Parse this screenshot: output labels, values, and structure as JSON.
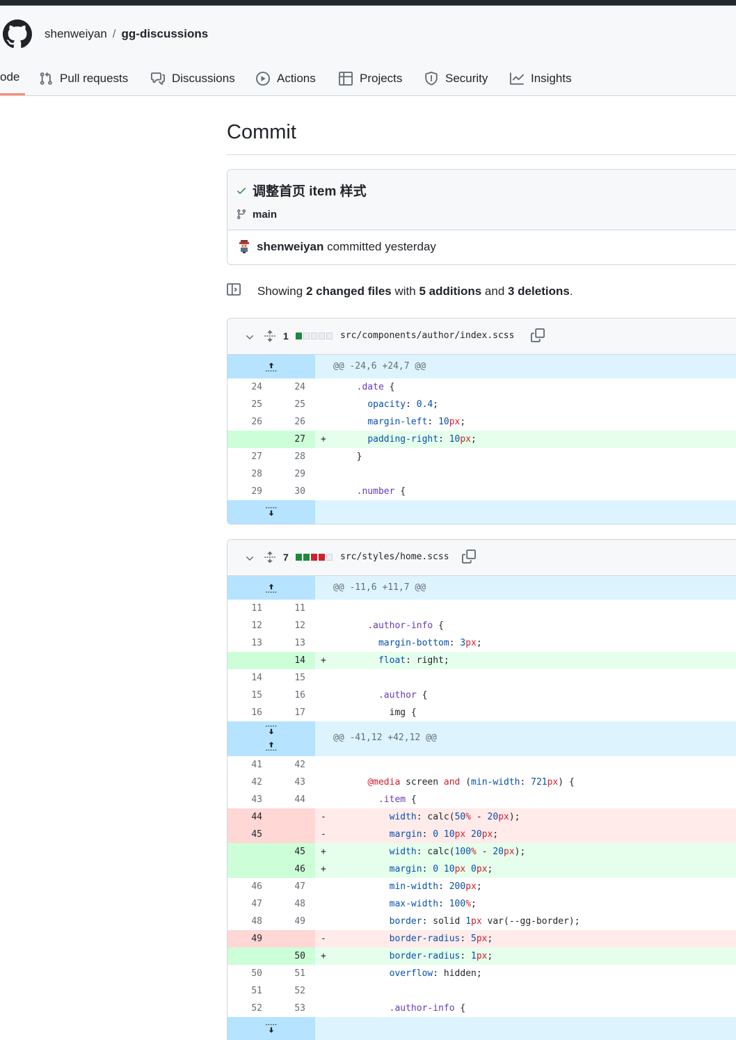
{
  "repo": {
    "owner": "shenweiyan",
    "separator": "/",
    "name": "gg-discussions"
  },
  "nav": [
    {
      "label": "ode",
      "icon": "code-icon",
      "active": true
    },
    {
      "label": "Pull requests",
      "icon": "pull-request-icon"
    },
    {
      "label": "Discussions",
      "icon": "discussions-icon"
    },
    {
      "label": "Actions",
      "icon": "play-icon"
    },
    {
      "label": "Projects",
      "icon": "table-icon"
    },
    {
      "label": "Security",
      "icon": "shield-icon"
    },
    {
      "label": "Insights",
      "icon": "graph-icon"
    }
  ],
  "page": {
    "title": "Commit"
  },
  "commit": {
    "message": "调整首页 item 样式",
    "branch": "main",
    "author": "shenweiyan",
    "action": " committed ",
    "time": "yesterday"
  },
  "summary": {
    "prefix": "Showing ",
    "files": "2 changed files",
    "mid1": " with ",
    "additions": "5 additions",
    "mid2": " and ",
    "deletions": "3 deletions",
    "suffix": "."
  },
  "files": [
    {
      "changes": "1",
      "path": "src/components/author/index.scss",
      "blocks": [
        "add",
        "none",
        "none",
        "none",
        "none"
      ],
      "hunks": [
        "@@ -24,6 +24,7 @@"
      ],
      "rows": [
        {
          "old": "24",
          "new": "24",
          "type": "ctx",
          "code": "  .date {"
        },
        {
          "old": "25",
          "new": "25",
          "type": "ctx",
          "code": "    opacity: 0.4;"
        },
        {
          "old": "26",
          "new": "26",
          "type": "ctx",
          "code": "    margin-left: 10px;"
        },
        {
          "old": "",
          "new": "27",
          "type": "add",
          "code": "    padding-right: 10px;"
        },
        {
          "old": "27",
          "new": "28",
          "type": "ctx",
          "code": "  }"
        },
        {
          "old": "28",
          "new": "29",
          "type": "ctx",
          "code": ""
        },
        {
          "old": "29",
          "new": "30",
          "type": "ctx",
          "code": "  .number {"
        }
      ]
    },
    {
      "changes": "7",
      "path": "src/styles/home.scss",
      "blocks": [
        "add",
        "add",
        "del",
        "del",
        "none"
      ],
      "hunks": [
        "@@ -11,6 +11,7 @@",
        "@@ -41,12 +42,12 @@"
      ],
      "rows_a": [
        {
          "old": "11",
          "new": "11",
          "type": "ctx",
          "code": ""
        },
        {
          "old": "12",
          "new": "12",
          "type": "ctx",
          "code": "    .author-info {"
        },
        {
          "old": "13",
          "new": "13",
          "type": "ctx",
          "code": "      margin-bottom: 3px;"
        },
        {
          "old": "",
          "new": "14",
          "type": "add",
          "code": "      float: right;"
        },
        {
          "old": "14",
          "new": "15",
          "type": "ctx",
          "code": ""
        },
        {
          "old": "15",
          "new": "16",
          "type": "ctx",
          "code": "      .author {"
        },
        {
          "old": "16",
          "new": "17",
          "type": "ctx",
          "code": "        img {"
        }
      ],
      "rows_b": [
        {
          "old": "41",
          "new": "42",
          "type": "ctx",
          "code": ""
        },
        {
          "old": "42",
          "new": "43",
          "type": "ctx",
          "code": "    @media screen and (min-width: 721px) {"
        },
        {
          "old": "43",
          "new": "44",
          "type": "ctx",
          "code": "      .item {"
        },
        {
          "old": "44",
          "new": "",
          "type": "del",
          "code": "        width: calc(50% - 20px);"
        },
        {
          "old": "45",
          "new": "",
          "type": "del",
          "code": "        margin: 0 10px 20px;"
        },
        {
          "old": "",
          "new": "45",
          "type": "add",
          "code": "        width: calc(100% - 20px);"
        },
        {
          "old": "",
          "new": "46",
          "type": "add",
          "code": "        margin: 0 10px 0px;"
        },
        {
          "old": "46",
          "new": "47",
          "type": "ctx",
          "code": "        min-width: 200px;"
        },
        {
          "old": "47",
          "new": "48",
          "type": "ctx",
          "code": "        max-width: 100%;"
        },
        {
          "old": "48",
          "new": "49",
          "type": "ctx",
          "code": "        border: solid 1px var(--gg-border);"
        },
        {
          "old": "49",
          "new": "",
          "type": "del",
          "code": "        border-radius: 5px;"
        },
        {
          "old": "",
          "new": "50",
          "type": "add",
          "code": "        border-radius: 1px;"
        },
        {
          "old": "50",
          "new": "51",
          "type": "ctx",
          "code": "        overflow: hidden;"
        },
        {
          "old": "51",
          "new": "52",
          "type": "ctx",
          "code": ""
        },
        {
          "old": "52",
          "new": "53",
          "type": "ctx",
          "code": "        .author-info {"
        }
      ]
    }
  ],
  "signs": {
    "add": "+",
    "del": "-"
  },
  "colors": {
    "accent": "#fd8c73",
    "add_bg": "#e6ffec",
    "del_bg": "#ffebe9",
    "hunk_bg": "#ddf4ff",
    "success": "#1f883d"
  }
}
